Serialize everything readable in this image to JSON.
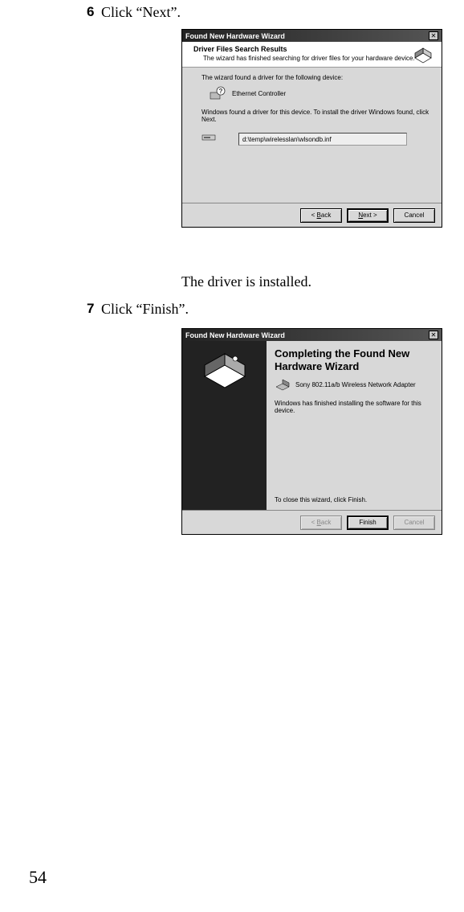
{
  "step6": {
    "num": "6",
    "text": "Click “Next”."
  },
  "body1": "The driver is installed.",
  "step7": {
    "num": "7",
    "text": "Click “Finish”."
  },
  "page": "54",
  "dialog1": {
    "title": "Found New Hardware Wizard",
    "header_title": "Driver Files Search Results",
    "header_sub": "The wizard has finished searching for driver files for your hardware device.",
    "line1": "The wizard found a driver for the following device:",
    "device": "Ethernet Controller",
    "line2": "Windows found a driver for this device. To install the driver Windows found, click Next.",
    "path": "d:\\temp\\wirelesslan\\wlsondb.inf",
    "back": "< Back",
    "next": "Next >",
    "cancel": "Cancel"
  },
  "dialog2": {
    "title": "Found New Hardware Wizard",
    "complete_title": "Completing the Found New Hardware Wizard",
    "adapter": "Sony 802.11a/b Wireless Network Adapter",
    "finished": "Windows has finished installing the software for this device.",
    "close": "To close this wizard, click Finish.",
    "back": "< Back",
    "finish": "Finish",
    "cancel": "Cancel"
  }
}
